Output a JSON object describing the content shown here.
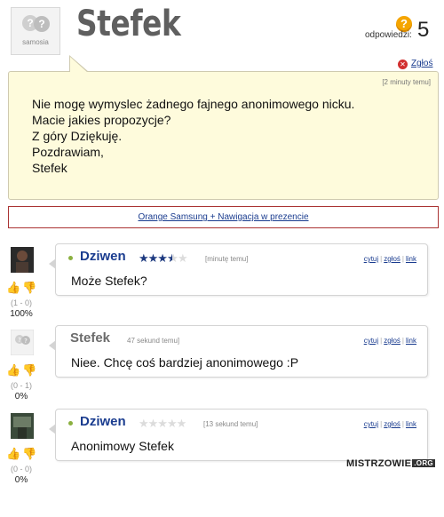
{
  "question": {
    "title": "Stefek",
    "avatar_caption": "samosia",
    "answers_label": "odpowiedzi:",
    "answers_count": "5",
    "report_label": "Zgłoś",
    "time": "[2 minuty temu]",
    "body_lines": [
      "Nie mogę wymyslec żadnego fajnego anonimowego nicku.",
      "Macie jakies propozycje?",
      "Z góry Dziękuję.",
      "Pozdrawiam,",
      "Stefek"
    ]
  },
  "ad": {
    "link_text": "Orange Samsung + Nawigacja w prezencie"
  },
  "actions": {
    "quote": "cytuj",
    "report": "zgłoś",
    "link": "link"
  },
  "answers": [
    {
      "author": "Dziwen",
      "rating": 3.5,
      "time": "[minutę temu]",
      "message": "Może Stefek?",
      "votes": "(1 - 0)",
      "percent": "100%",
      "thumb_up_active": true,
      "thumb_down_active": false
    },
    {
      "author": "Stefek",
      "time": "47 sekund temu]",
      "message": "Niee. Chcę coś bardziej anonimowego :P",
      "votes": "(0 - 1)",
      "percent": "0%",
      "thumb_up_active": true,
      "thumb_down_active": true
    },
    {
      "author": "Dziwen",
      "rating": 0,
      "time": "[13 sekund temu]",
      "message": "Anonimowy Stefek",
      "votes": "(0 - 0)",
      "percent": "0%",
      "thumb_up_active": true,
      "thumb_down_active": true
    }
  ],
  "watermark": {
    "text": "MISTRZOWIE",
    "suffix": ".ORG"
  },
  "icons": {
    "question_badge": "question-mark-icon",
    "report": "report-x-icon",
    "thumb_up": "thumb-up-icon",
    "thumb_down": "thumb-down-icon"
  },
  "colors": {
    "link": "#1a3c8f",
    "bubble_bg": "#fefbdc",
    "ad_border": "#aa3333",
    "thumb_up": "#b44cb0",
    "thumb_down": "#e3b020"
  }
}
